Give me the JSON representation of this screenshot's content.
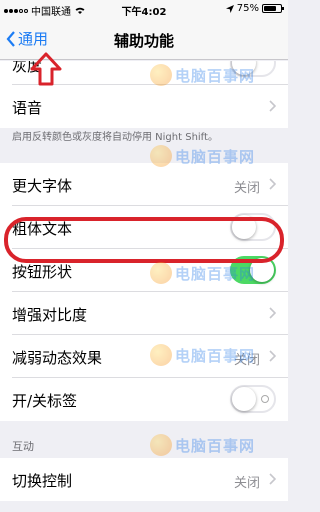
{
  "status_bar": {
    "carrier": "中国联通",
    "time": "下午4:02",
    "battery": "75%"
  },
  "nav": {
    "back_label": "通用",
    "title": "辅助功能"
  },
  "partial_cell": {
    "label": "灰度"
  },
  "rows": {
    "speech": {
      "label": "语音"
    },
    "larger_text": {
      "label": "更大字体",
      "value": "关闭"
    },
    "bold_text": {
      "label": "粗体文本",
      "on": false
    },
    "button_shapes": {
      "label": "按钮形状",
      "on": true
    },
    "increase_contrast": {
      "label": "增强对比度"
    },
    "reduce_motion": {
      "label": "减弱动态效果",
      "value": "关闭"
    },
    "on_off_labels": {
      "label": "开/关标签",
      "on": false
    },
    "switch_control": {
      "label": "切换控制",
      "value": "关闭"
    }
  },
  "footer_text": "启用反转颜色或灰度将自动停用 Night Shift。",
  "section_interaction": "互动",
  "watermark": {
    "text": "电脑百事网"
  },
  "colors": {
    "accent": "#1c7cf4",
    "toggle_on": "#4cd964",
    "highlight": "#d9232b"
  }
}
